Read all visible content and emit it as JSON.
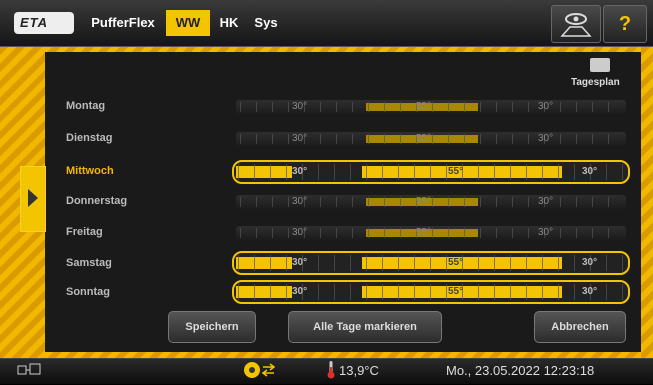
{
  "header": {
    "logo": "ETA",
    "tabs": [
      {
        "label": "PufferFlex",
        "active": false
      },
      {
        "label": "WW",
        "active": true
      },
      {
        "label": "HK",
        "active": false
      },
      {
        "label": "Sys",
        "active": false
      }
    ],
    "help_label": "?"
  },
  "schedule": {
    "tagesplan_label": "Tagesplan",
    "days": [
      {
        "label": "Montag",
        "selected": false,
        "values": [
          "30°",
          "55°",
          "30°"
        ]
      },
      {
        "label": "Dienstag",
        "selected": false,
        "values": [
          "30°",
          "55°",
          "30°"
        ]
      },
      {
        "label": "Mittwoch",
        "selected": true,
        "values": [
          "30°",
          "55°",
          "30°"
        ]
      },
      {
        "label": "Donnerstag",
        "selected": false,
        "values": [
          "30°",
          "55°",
          "30°"
        ]
      },
      {
        "label": "Freitag",
        "selected": false,
        "values": [
          "30°",
          "55°",
          "30°"
        ]
      },
      {
        "label": "Samstag",
        "selected": true,
        "values": [
          "30°",
          "55°",
          "30°"
        ]
      },
      {
        "label": "Sonntag",
        "selected": true,
        "values": [
          "30°",
          "55°",
          "30°"
        ]
      }
    ]
  },
  "buttons": {
    "save": "Speichern",
    "mark_all": "Alle Tage markieren",
    "cancel": "Abbrechen"
  },
  "status": {
    "temperature": "13,9°C",
    "datetime": "Mo., 23.05.2022 12:23:18"
  },
  "colors": {
    "accent": "#f2c500",
    "background": "#000000"
  }
}
